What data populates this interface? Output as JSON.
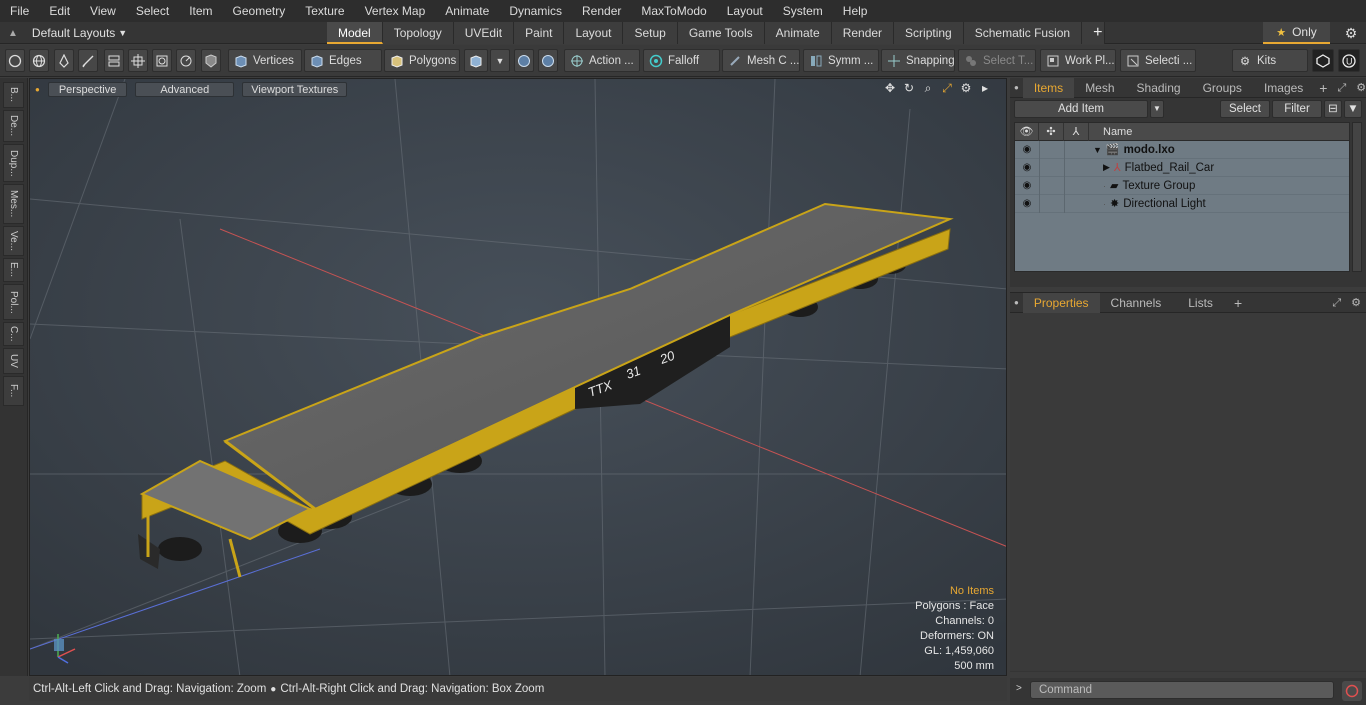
{
  "menu": [
    "File",
    "Edit",
    "View",
    "Select",
    "Item",
    "Geometry",
    "Texture",
    "Vertex Map",
    "Animate",
    "Dynamics",
    "Render",
    "MaxToModo",
    "Layout",
    "System",
    "Help"
  ],
  "layout_select": "Default Layouts",
  "tabs": [
    {
      "label": "Model",
      "active": true
    },
    {
      "label": "Topology"
    },
    {
      "label": "UVEdit"
    },
    {
      "label": "Paint"
    },
    {
      "label": "Layout"
    },
    {
      "label": "Setup"
    },
    {
      "label": "Game Tools"
    },
    {
      "label": "Animate"
    },
    {
      "label": "Render"
    },
    {
      "label": "Scripting"
    },
    {
      "label": "Schematic Fusion"
    }
  ],
  "only_label": "Only",
  "toolbar": {
    "vertices": "Vertices",
    "edges": "Edges",
    "polygons": "Polygons",
    "action": "Action ...",
    "falloff": "Falloff",
    "mesh": "Mesh C ...",
    "symm": "Symm ...",
    "snapping": "Snapping",
    "select_t": "Select T...",
    "work_pl": "Work Pl...",
    "selecti": "Selecti ...",
    "kits": "Kits"
  },
  "left_tabs": [
    "B...",
    "De...",
    "Dup...",
    "Mes...",
    "Ve...",
    "E...",
    "Pol...",
    "C...",
    "UV",
    "F..."
  ],
  "viewport": {
    "perspective": "Perspective",
    "advanced": "Advanced",
    "textures": "Viewport Textures",
    "info": {
      "no_items": "No Items",
      "polygons": "Polygons : Face",
      "channels": "Channels: 0",
      "deformers": "Deformers: ON",
      "gl": "GL: 1,459,060",
      "scale": "500 mm"
    },
    "car_markings": [
      "TTX",
      "31",
      "20"
    ]
  },
  "status": {
    "left": "Ctrl-Alt-Left Click and Drag: Navigation: Zoom",
    "right": "Ctrl-Alt-Right Click and Drag: Navigation: Box Zoom"
  },
  "items_panel": {
    "tabs": [
      "Items",
      "Mesh ...",
      "Shading",
      "Groups",
      "Images"
    ],
    "add_item": "Add Item",
    "select": "Select",
    "filter": "Filter",
    "name_col": "Name",
    "tree": [
      {
        "label": "modo.lxo",
        "level": 0
      },
      {
        "label": "Flatbed_Rail_Car",
        "level": 1
      },
      {
        "label": "Texture Group",
        "level": 1
      },
      {
        "label": "Directional Light",
        "level": 1
      }
    ]
  },
  "props_panel": {
    "tabs": [
      "Properties",
      "Channels",
      "Lists"
    ]
  },
  "command_placeholder": "Command"
}
